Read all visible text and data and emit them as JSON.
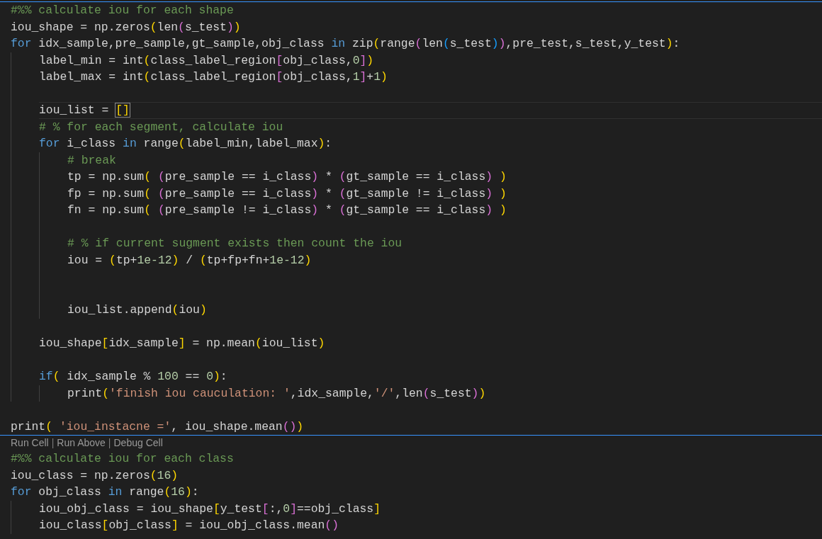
{
  "cells": [
    {
      "lines": [
        {
          "kind": "code",
          "tokens": [
            {
              "kind": "comment",
              "text": "#%% calculate iou for each shape"
            }
          ]
        },
        {
          "kind": "code",
          "tokens": [
            {
              "kind": "plain",
              "text": "iou_shape = np.zeros"
            },
            {
              "kind": "bracket1",
              "text": "("
            },
            {
              "kind": "plain",
              "text": "len"
            },
            {
              "kind": "bracket2",
              "text": "("
            },
            {
              "kind": "plain",
              "text": "s_test"
            },
            {
              "kind": "bracket2",
              "text": ")"
            },
            {
              "kind": "bracket1",
              "text": ")"
            }
          ]
        },
        {
          "kind": "code",
          "tokens": [
            {
              "kind": "keyword",
              "text": "for"
            },
            {
              "kind": "plain",
              "text": " idx_sample,pre_sample,gt_sample,obj_class "
            },
            {
              "kind": "keyword",
              "text": "in"
            },
            {
              "kind": "plain",
              "text": " zip"
            },
            {
              "kind": "bracket1",
              "text": "("
            },
            {
              "kind": "plain",
              "text": "range"
            },
            {
              "kind": "bracket2",
              "text": "("
            },
            {
              "kind": "plain",
              "text": "len"
            },
            {
              "kind": "bracket3",
              "text": "("
            },
            {
              "kind": "plain",
              "text": "s_test"
            },
            {
              "kind": "bracket3",
              "text": ")"
            },
            {
              "kind": "bracket2",
              "text": ")"
            },
            {
              "kind": "plain",
              "text": ",pre_test,s_test,y_test"
            },
            {
              "kind": "bracket1",
              "text": ")"
            },
            {
              "kind": "plain",
              "text": ":"
            }
          ],
          "children": [
            {
              "kind": "code",
              "tokens": [
                {
                  "kind": "plain",
                  "text": "label_min = int"
                },
                {
                  "kind": "bracket1",
                  "text": "("
                },
                {
                  "kind": "plain",
                  "text": "class_label_region"
                },
                {
                  "kind": "bracket2",
                  "text": "["
                },
                {
                  "kind": "plain",
                  "text": "obj_class,"
                },
                {
                  "kind": "number",
                  "text": "0"
                },
                {
                  "kind": "bracket2",
                  "text": "]"
                },
                {
                  "kind": "bracket1",
                  "text": ")"
                }
              ]
            },
            {
              "kind": "code",
              "tokens": [
                {
                  "kind": "plain",
                  "text": "label_max = int"
                },
                {
                  "kind": "bracket1",
                  "text": "("
                },
                {
                  "kind": "plain",
                  "text": "class_label_region"
                },
                {
                  "kind": "bracket2",
                  "text": "["
                },
                {
                  "kind": "plain",
                  "text": "obj_class,"
                },
                {
                  "kind": "number",
                  "text": "1"
                },
                {
                  "kind": "bracket2",
                  "text": "]"
                },
                {
                  "kind": "plain",
                  "text": "+"
                },
                {
                  "kind": "number",
                  "text": "1"
                },
                {
                  "kind": "bracket1",
                  "text": ")"
                }
              ]
            },
            {
              "kind": "blank"
            },
            {
              "kind": "code",
              "current": true,
              "tokens": [
                {
                  "kind": "plain",
                  "text": "iou_list = "
                },
                {
                  "kind": "matched",
                  "text": "[]"
                }
              ]
            },
            {
              "kind": "code",
              "tokens": [
                {
                  "kind": "comment",
                  "text": "# % for each segment, calculate iou"
                }
              ]
            },
            {
              "kind": "code",
              "tokens": [
                {
                  "kind": "keyword",
                  "text": "for"
                },
                {
                  "kind": "plain",
                  "text": " i_class "
                },
                {
                  "kind": "keyword",
                  "text": "in"
                },
                {
                  "kind": "plain",
                  "text": " range"
                },
                {
                  "kind": "bracket1",
                  "text": "("
                },
                {
                  "kind": "plain",
                  "text": "label_min,label_max"
                },
                {
                  "kind": "bracket1",
                  "text": ")"
                },
                {
                  "kind": "plain",
                  "text": ":"
                }
              ],
              "children": [
                {
                  "kind": "code",
                  "tokens": [
                    {
                      "kind": "comment",
                      "text": "# break"
                    }
                  ]
                },
                {
                  "kind": "code",
                  "tokens": [
                    {
                      "kind": "plain",
                      "text": "tp = np.sum"
                    },
                    {
                      "kind": "bracket1",
                      "text": "("
                    },
                    {
                      "kind": "bracket2",
                      "text": " ("
                    },
                    {
                      "kind": "plain",
                      "text": "pre_sample == i_class"
                    },
                    {
                      "kind": "bracket2",
                      "text": ")"
                    },
                    {
                      "kind": "plain",
                      "text": " * "
                    },
                    {
                      "kind": "bracket2",
                      "text": "("
                    },
                    {
                      "kind": "plain",
                      "text": "gt_sample == i_class"
                    },
                    {
                      "kind": "bracket2",
                      "text": ") "
                    },
                    {
                      "kind": "bracket1",
                      "text": ")"
                    }
                  ]
                },
                {
                  "kind": "code",
                  "tokens": [
                    {
                      "kind": "plain",
                      "text": "fp = np.sum"
                    },
                    {
                      "kind": "bracket1",
                      "text": "("
                    },
                    {
                      "kind": "bracket2",
                      "text": " ("
                    },
                    {
                      "kind": "plain",
                      "text": "pre_sample == i_class"
                    },
                    {
                      "kind": "bracket2",
                      "text": ")"
                    },
                    {
                      "kind": "plain",
                      "text": " * "
                    },
                    {
                      "kind": "bracket2",
                      "text": "("
                    },
                    {
                      "kind": "plain",
                      "text": "gt_sample != i_class"
                    },
                    {
                      "kind": "bracket2",
                      "text": ") "
                    },
                    {
                      "kind": "bracket1",
                      "text": ")"
                    }
                  ]
                },
                {
                  "kind": "code",
                  "tokens": [
                    {
                      "kind": "plain",
                      "text": "fn = np.sum"
                    },
                    {
                      "kind": "bracket1",
                      "text": "("
                    },
                    {
                      "kind": "bracket2",
                      "text": " ("
                    },
                    {
                      "kind": "plain",
                      "text": "pre_sample != i_class"
                    },
                    {
                      "kind": "bracket2",
                      "text": ")"
                    },
                    {
                      "kind": "plain",
                      "text": " * "
                    },
                    {
                      "kind": "bracket2",
                      "text": "("
                    },
                    {
                      "kind": "plain",
                      "text": "gt_sample == i_class"
                    },
                    {
                      "kind": "bracket2",
                      "text": ") "
                    },
                    {
                      "kind": "bracket1",
                      "text": ")"
                    }
                  ]
                },
                {
                  "kind": "blank"
                },
                {
                  "kind": "code",
                  "tokens": [
                    {
                      "kind": "comment",
                      "text": "# % if current sugment exists then count the iou"
                    }
                  ]
                },
                {
                  "kind": "code",
                  "tokens": [
                    {
                      "kind": "plain",
                      "text": "iou = "
                    },
                    {
                      "kind": "bracket1",
                      "text": "("
                    },
                    {
                      "kind": "plain",
                      "text": "tp+"
                    },
                    {
                      "kind": "number",
                      "text": "1e-12"
                    },
                    {
                      "kind": "bracket1",
                      "text": ")"
                    },
                    {
                      "kind": "plain",
                      "text": " / "
                    },
                    {
                      "kind": "bracket1",
                      "text": "("
                    },
                    {
                      "kind": "plain",
                      "text": "tp+fp+fn+"
                    },
                    {
                      "kind": "number",
                      "text": "1e-12"
                    },
                    {
                      "kind": "bracket1",
                      "text": ")"
                    }
                  ]
                },
                {
                  "kind": "blank"
                },
                {
                  "kind": "blank"
                },
                {
                  "kind": "code",
                  "tokens": [
                    {
                      "kind": "plain",
                      "text": "iou_list.append"
                    },
                    {
                      "kind": "bracket1",
                      "text": "("
                    },
                    {
                      "kind": "plain",
                      "text": "iou"
                    },
                    {
                      "kind": "bracket1",
                      "text": ")"
                    }
                  ]
                }
              ]
            },
            {
              "kind": "blank"
            },
            {
              "kind": "code",
              "tokens": [
                {
                  "kind": "plain",
                  "text": "iou_shape"
                },
                {
                  "kind": "bracket1",
                  "text": "["
                },
                {
                  "kind": "plain",
                  "text": "idx_sample"
                },
                {
                  "kind": "bracket1",
                  "text": "]"
                },
                {
                  "kind": "plain",
                  "text": " = np.mean"
                },
                {
                  "kind": "bracket1",
                  "text": "("
                },
                {
                  "kind": "plain",
                  "text": "iou_list"
                },
                {
                  "kind": "bracket1",
                  "text": ")"
                }
              ]
            },
            {
              "kind": "blank"
            },
            {
              "kind": "code",
              "tokens": [
                {
                  "kind": "keyword",
                  "text": "if"
                },
                {
                  "kind": "bracket1",
                  "text": "("
                },
                {
                  "kind": "plain",
                  "text": " idx_sample % "
                },
                {
                  "kind": "number",
                  "text": "100"
                },
                {
                  "kind": "plain",
                  "text": " == "
                },
                {
                  "kind": "number",
                  "text": "0"
                },
                {
                  "kind": "bracket1",
                  "text": ")"
                },
                {
                  "kind": "plain",
                  "text": ":"
                }
              ],
              "children": [
                {
                  "kind": "code",
                  "tokens": [
                    {
                      "kind": "plain",
                      "text": "print"
                    },
                    {
                      "kind": "bracket1",
                      "text": "("
                    },
                    {
                      "kind": "string",
                      "text": "'finish iou cauculation: '"
                    },
                    {
                      "kind": "plain",
                      "text": ",idx_sample,"
                    },
                    {
                      "kind": "string",
                      "text": "'/'"
                    },
                    {
                      "kind": "plain",
                      "text": ",len"
                    },
                    {
                      "kind": "bracket2",
                      "text": "("
                    },
                    {
                      "kind": "plain",
                      "text": "s_test"
                    },
                    {
                      "kind": "bracket2",
                      "text": ")"
                    },
                    {
                      "kind": "bracket1",
                      "text": ")"
                    }
                  ]
                }
              ]
            }
          ]
        },
        {
          "kind": "blank"
        },
        {
          "kind": "code",
          "tokens": [
            {
              "kind": "plain",
              "text": "print"
            },
            {
              "kind": "bracket1",
              "text": "( "
            },
            {
              "kind": "string",
              "text": "'iou_instacne ='"
            },
            {
              "kind": "plain",
              "text": ", iou_shape.mean"
            },
            {
              "kind": "bracket2",
              "text": "()"
            },
            {
              "kind": "bracket1",
              "text": ")"
            }
          ]
        }
      ]
    },
    {
      "codelens": [
        {
          "kind": "link",
          "text": "Run Cell"
        },
        {
          "kind": "sep",
          "text": "|"
        },
        {
          "kind": "link",
          "text": "Run Above"
        },
        {
          "kind": "sep",
          "text": "|"
        },
        {
          "kind": "link",
          "text": "Debug Cell"
        }
      ],
      "lines": [
        {
          "kind": "code",
          "tokens": [
            {
              "kind": "comment",
              "text": "#%% calculate iou for each class"
            }
          ]
        },
        {
          "kind": "code",
          "tokens": [
            {
              "kind": "plain",
              "text": "iou_class = np.zeros"
            },
            {
              "kind": "bracket1",
              "text": "("
            },
            {
              "kind": "number",
              "text": "16"
            },
            {
              "kind": "bracket1",
              "text": ")"
            }
          ]
        },
        {
          "kind": "code",
          "tokens": [
            {
              "kind": "keyword",
              "text": "for"
            },
            {
              "kind": "plain",
              "text": " obj_class "
            },
            {
              "kind": "keyword",
              "text": "in"
            },
            {
              "kind": "plain",
              "text": " range"
            },
            {
              "kind": "bracket1",
              "text": "("
            },
            {
              "kind": "number",
              "text": "16"
            },
            {
              "kind": "bracket1",
              "text": ")"
            },
            {
              "kind": "plain",
              "text": ":"
            }
          ],
          "children": [
            {
              "kind": "code",
              "tokens": [
                {
                  "kind": "plain",
                  "text": "iou_obj_class = iou_shape"
                },
                {
                  "kind": "bracket1",
                  "text": "["
                },
                {
                  "kind": "plain",
                  "text": "y_test"
                },
                {
                  "kind": "bracket2",
                  "text": "["
                },
                {
                  "kind": "plain",
                  "text": ":,"
                },
                {
                  "kind": "number",
                  "text": "0"
                },
                {
                  "kind": "bracket2",
                  "text": "]"
                },
                {
                  "kind": "plain",
                  "text": "==obj_class"
                },
                {
                  "kind": "bracket1",
                  "text": "]"
                }
              ]
            },
            {
              "kind": "code",
              "tokens": [
                {
                  "kind": "plain",
                  "text": "iou_class"
                },
                {
                  "kind": "bracket1",
                  "text": "["
                },
                {
                  "kind": "plain",
                  "text": "obj_class"
                },
                {
                  "kind": "bracket1",
                  "text": "]"
                },
                {
                  "kind": "plain",
                  "text": " = iou_obj_class.mean"
                },
                {
                  "kind": "bracket2",
                  "text": "()"
                }
              ]
            }
          ]
        }
      ]
    }
  ]
}
